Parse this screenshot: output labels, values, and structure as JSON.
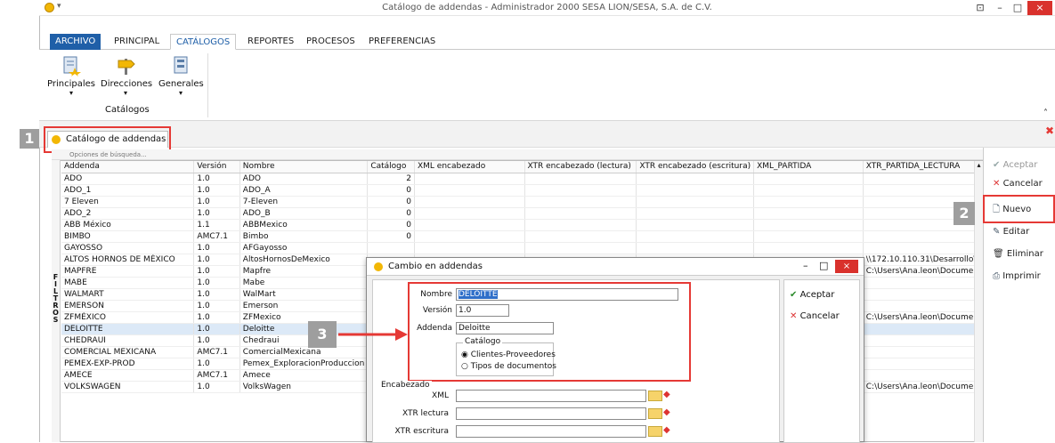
{
  "window": {
    "title": "Catálogo de addendas - Administrador 2000 SESA LION/SESA, S.A. de C.V.",
    "minimize": "–",
    "maximize": "□",
    "close": "×",
    "pin": "⊡"
  },
  "ribbon_tabs": [
    "ARCHIVO",
    "PRINCIPAL",
    "CATÁLOGOS",
    "REPORTES",
    "PROCESOS",
    "PREFERENCIAS"
  ],
  "ribbon": {
    "buttons": [
      "Principales",
      "Direcciones",
      "Generales"
    ],
    "group_label": "Catálogos"
  },
  "doc_tab": {
    "label": "Catálogo de addendas",
    "close": "×"
  },
  "callouts": [
    "1",
    "2",
    "3"
  ],
  "search_options": "Opciones de búsqueda...",
  "filtros_label": "FILTROS",
  "grid": {
    "columns": [
      "Addenda",
      "Versión",
      "Nombre",
      "Catálogo",
      "XML encabezado",
      "XTR encabezado (lectura)",
      "XTR encabezado (escritura)",
      "XML_PARTIDA",
      "XTR_PARTIDA_LECTURA"
    ],
    "rows": [
      [
        "ADO",
        "1.0",
        "ADO",
        "2",
        "",
        "",
        "",
        "",
        ""
      ],
      [
        "ADO_1",
        "1.0",
        "ADO_A",
        "0",
        "",
        "",
        "",
        "",
        ""
      ],
      [
        "7 Eleven",
        "1.0",
        "7-Eleven",
        "0",
        "",
        "",
        "",
        "",
        ""
      ],
      [
        "ADO_2",
        "1.0",
        "ADO_B",
        "0",
        "",
        "",
        "",
        "",
        ""
      ],
      [
        "ABB México",
        "1.1",
        "ABBMexico",
        "0",
        "",
        "",
        "",
        "",
        ""
      ],
      [
        "BIMBO",
        "AMC7.1",
        "Bimbo",
        "0",
        "",
        "",
        "",
        "",
        ""
      ],
      [
        "GAYOSSO",
        "1.0",
        "AFGayosso",
        "",
        "",
        "",
        "",
        "",
        ""
      ],
      [
        "ALTOS HORNOS DE MÉXICO",
        "1.0",
        "AltosHornosDeMexico",
        "",
        "",
        "",
        "",
        "",
        "\\\\172.10.110.31\\Desarrollo\\"
      ],
      [
        "MAPFRE",
        "1.0",
        "Mapfre",
        "",
        "",
        "",
        "",
        "",
        "C:\\Users\\Ana.leon\\Documen"
      ],
      [
        "MABE",
        "1.0",
        "Mabe",
        "",
        "",
        "",
        "",
        "",
        ""
      ],
      [
        "WALMART",
        "1.0",
        "WalMart",
        "",
        "",
        "",
        "",
        "",
        ""
      ],
      [
        "EMERSON",
        "1.0",
        "Emerson",
        "",
        "",
        "",
        "",
        "",
        ""
      ],
      [
        "ZFMÉXICO",
        "1.0",
        "ZFMexico",
        "",
        "",
        "",
        "",
        "",
        "C:\\Users\\Ana.leon\\Documen"
      ],
      [
        "DELOITTE",
        "1.0",
        "Deloitte",
        "",
        "",
        "",
        "",
        "",
        ""
      ],
      [
        "CHEDRAUI",
        "1.0",
        "Chedraui",
        "",
        "",
        "",
        "",
        "",
        ""
      ],
      [
        "COMERCIAL MEXICANA",
        "AMC7.1",
        "ComercialMexicana",
        "",
        "",
        "",
        "",
        "",
        ""
      ],
      [
        "PEMEX-EXP-PROD",
        "1.0",
        "Pemex_ExploracionProduccion",
        "",
        "",
        "",
        "",
        "",
        ""
      ],
      [
        "AMECE",
        "AMC7.1",
        "Amece",
        "",
        "",
        "",
        "",
        "",
        ""
      ],
      [
        "VOLKSWAGEN",
        "1.0",
        "VolksWagen",
        "",
        "",
        "",
        "",
        "",
        "C:\\Users\\Ana.leon\\Documen"
      ]
    ]
  },
  "side_actions": [
    "Aceptar",
    "Cancelar",
    "Nuevo",
    "Editar",
    "Eliminar",
    "Imprimir"
  ],
  "dialog": {
    "title": "Cambio en addendas",
    "nombre_label": "Nombre",
    "nombre_value": "DELOITTE",
    "version_label": "Versión",
    "version_value": "1.0",
    "addenda_label": "Addenda",
    "addenda_value": "Deloitte",
    "catalogo_label": "Catálogo",
    "radio1": "Clientes-Proveedores",
    "radio2": "Tipos de documentos",
    "encabezado_label": "Encabezado",
    "xml_label": "XML",
    "xtr_lectura_label": "XTR lectura",
    "xtr_escritura_label": "XTR escritura",
    "accept": "Aceptar",
    "cancel": "Cancelar"
  },
  "colors": {
    "accent": "#1f5fa8",
    "highlight": "#e53935",
    "close": "#d9312c"
  }
}
